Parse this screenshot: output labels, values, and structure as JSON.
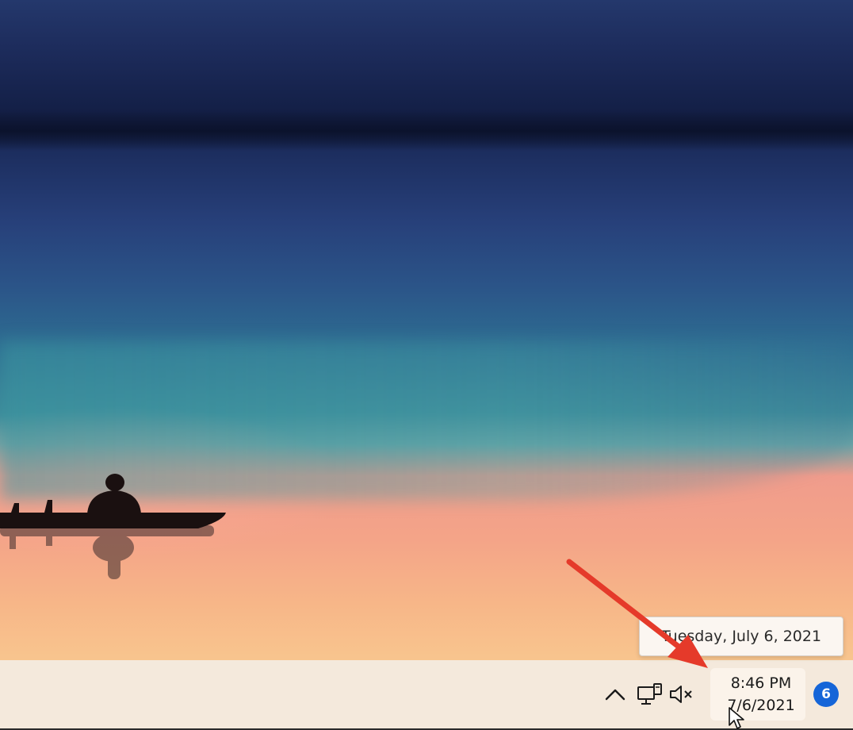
{
  "tooltip": {
    "text": "Tuesday, July 6, 2021"
  },
  "taskbar": {
    "tray": {
      "overflow_icon": "chevron-up-icon",
      "network_icon": "network-computer-icon",
      "volume_icon": "volume-muted-icon",
      "clock": {
        "time": "8:46 PM",
        "date": "7/6/2021"
      },
      "notifications": {
        "count": "6"
      }
    }
  },
  "colors": {
    "badge": "#1565d8",
    "arrow": "#e53a2a",
    "taskbar": "#f4e9dc"
  }
}
